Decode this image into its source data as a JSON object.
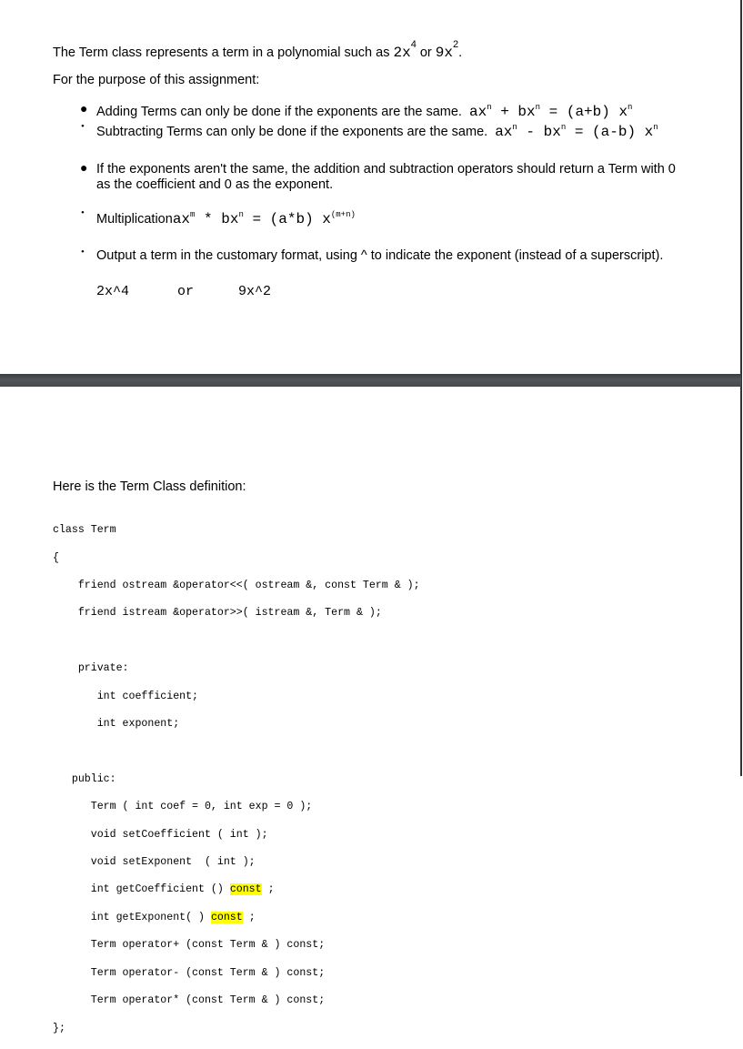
{
  "page1": {
    "intro_text": "The Term class represents a term in a polynomial such as",
    "intro_ex1_base": "2x",
    "intro_ex1_exp": "4",
    "intro_or": "or",
    "intro_ex2_base": "9x",
    "intro_ex2_exp": "2",
    "intro_end": ".",
    "purpose": "For the purpose of this assignment:",
    "bullets": [
      {
        "text": "Adding Terms can only be done if the exponents are the same.",
        "math": "axⁿ + bxⁿ = (a+b) xⁿ"
      },
      {
        "text": "Subtracting Terms can only be done if the exponents are the same.",
        "math": "axⁿ - bxⁿ = (a-b) xⁿ"
      },
      {
        "text_line1": "If the exponents aren't the same, the addition and subtraction operators should return a Term with 0",
        "text_line2": "as the coefficient and 0 as the exponent."
      },
      {
        "text": "Multiplication",
        "math_a": "ax",
        "math_a_exp": "m",
        "math_b": " * bx",
        "math_b_exp": "n",
        "math_c": " = (a*b) x",
        "math_c_exp": "(m+n)"
      },
      {
        "text": "Output a term in the customary format, using ^ to indicate the exponent (instead of a superscript)."
      }
    ],
    "output_examples": [
      "2x^4",
      "or",
      "9x^2"
    ],
    "math_parts": {
      "add": {
        "l": "ax",
        "op1": " + bx",
        "eq": " = (a+b) x",
        "exp": "n"
      },
      "sub": {
        "l": "ax",
        "op1": " - bx",
        "eq": " = (a-b) x",
        "exp": "n"
      }
    }
  },
  "page2": {
    "heading": "Here is the Term Class definition:",
    "code_lines": [
      "class Term",
      "{",
      "    friend ostream &operator<<( ostream &, const Term & );",
      "    friend istream &operator>>( istream &, Term & );",
      "",
      "    private:",
      "       int coefficient;",
      "       int exponent;",
      "",
      "   public:",
      "      Term ( int coef = 0, int exp = 0 );",
      "      void setCoefficient ( int );",
      "      void setExponent  ( int );",
      "      int getCoefficient () ",
      "      int getExponent( ) ",
      "      Term operator+ (const Term & ) const;",
      "      Term operator- (const Term & ) const;",
      "      Term operator* (const Term & ) const;",
      "};"
    ],
    "highlight_word": "const",
    "after_highlight": " ;"
  }
}
